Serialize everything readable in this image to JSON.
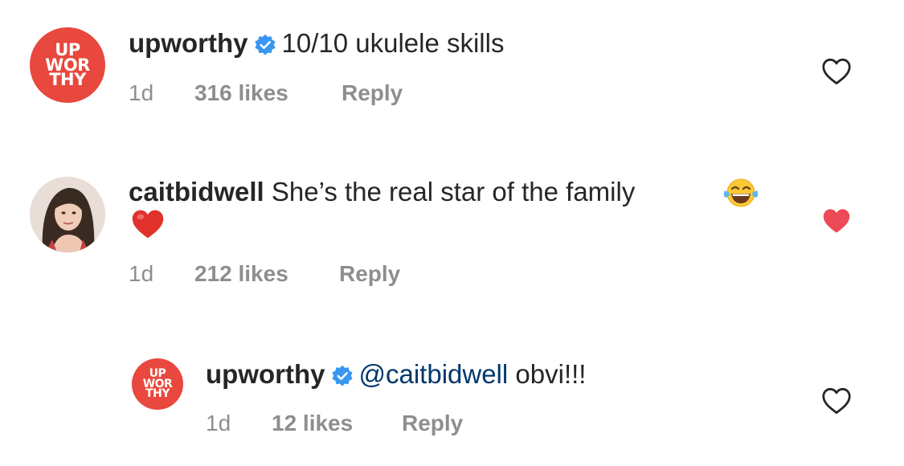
{
  "comments": [
    {
      "avatar_text": [
        "UP",
        "WOR",
        "THY"
      ],
      "username": "upworthy",
      "verified": true,
      "mention": "",
      "text": "10/10 ukulele skills",
      "time": "1d",
      "likes": "316 likes",
      "reply": "Reply",
      "liked": false
    },
    {
      "avatar_text": [],
      "username": "caitbidwell",
      "verified": false,
      "mention": "",
      "text": "She’s the real star of the family",
      "emojis": [
        "laughing-tears-emoji",
        "red-heart-emoji"
      ],
      "time": "1d",
      "likes": "212 likes",
      "reply": "Reply",
      "liked": true
    },
    {
      "avatar_text": [
        "UP",
        "WOR",
        "THY"
      ],
      "username": "upworthy",
      "verified": true,
      "mention": "@caitbidwell",
      "text": "obvi!!!",
      "time": "1d",
      "likes": "12 likes",
      "reply": "Reply",
      "liked": false
    }
  ],
  "colors": {
    "brand": "#e8483d",
    "verified": "#3897f0",
    "liked_heart": "#ed4956",
    "meta_text": "#8e8e8e",
    "mention": "#00376b"
  }
}
